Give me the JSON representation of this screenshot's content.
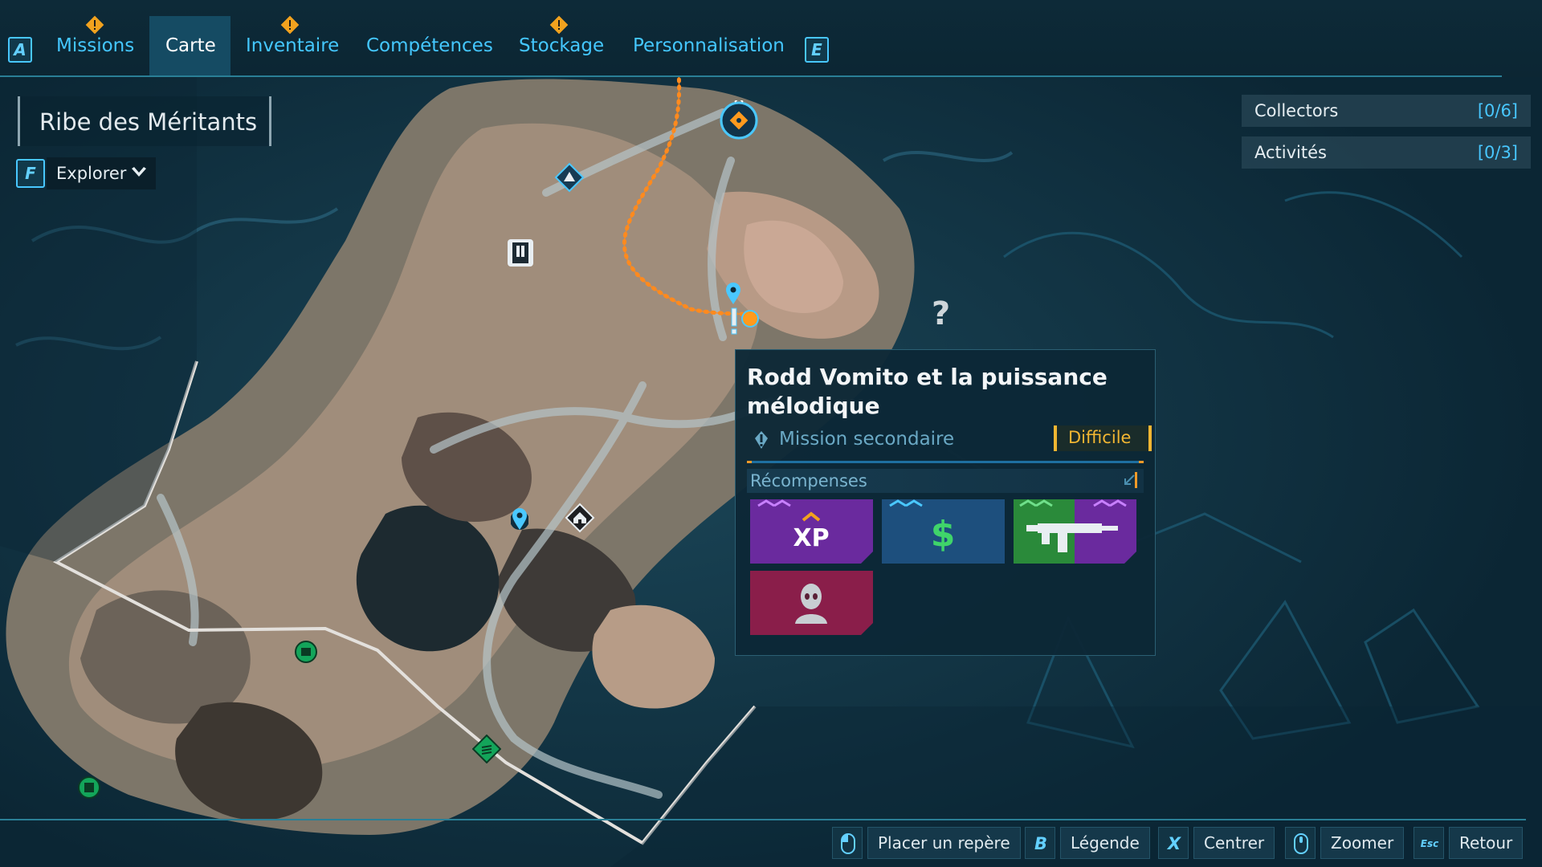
{
  "tabs": {
    "left_key": "A",
    "right_key": "E",
    "items": [
      {
        "label": "Missions",
        "alert": true
      },
      {
        "label": "Carte",
        "active": true
      },
      {
        "label": "Inventaire",
        "alert": true
      },
      {
        "label": "Compétences"
      },
      {
        "label": "Stockage",
        "alert": true
      },
      {
        "label": "Personnalisation"
      }
    ]
  },
  "region": {
    "name": "Ribe des Méritants"
  },
  "filter": {
    "key": "F",
    "label": "Explorer"
  },
  "trackers": [
    {
      "label": "Collectors",
      "count": "[0/6]"
    },
    {
      "label": "Activités",
      "count": "[0/3]"
    }
  ],
  "map_markers": {
    "unknown": "?"
  },
  "mission": {
    "title": "Rodd Vomito et la puissance mélodique",
    "type": "Mission secondaire",
    "difficulty": "Difficile",
    "rewards_label": "Récompenses",
    "rewards": [
      {
        "kind": "xp",
        "label": "XP",
        "color": "#6a2a9e"
      },
      {
        "kind": "cash",
        "label": "$",
        "color": "#1d4f7d"
      },
      {
        "kind": "weapon",
        "label": "weapon-icon",
        "color": "#2a8a3a"
      },
      {
        "kind": "cosmetic",
        "label": "head-icon",
        "color": "#8a1e4a"
      }
    ]
  },
  "hints": [
    {
      "key": "mouse-left",
      "label": "Placer un repère"
    },
    {
      "key": "B",
      "label": "Légende"
    },
    {
      "key": "X",
      "label": "Centrer"
    },
    {
      "key": "mouse-wheel",
      "label": "Zoomer"
    },
    {
      "key": "Esc",
      "label": "Retour"
    }
  ],
  "colors": {
    "accent": "#44c7ff",
    "route": "#ff8a1e",
    "difficulty": "#f2b632",
    "background": "#0a2331"
  }
}
